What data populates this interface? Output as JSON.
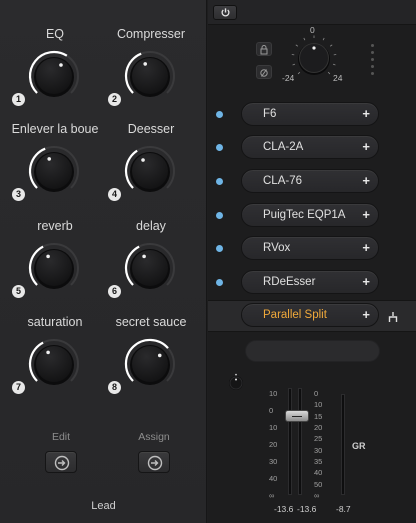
{
  "macros": {
    "knobs": [
      {
        "label": "EQ",
        "number": "1",
        "value": 0.62
      },
      {
        "label": "Compresser",
        "number": "2",
        "value": 0.42
      },
      {
        "label": "Enlever la boue",
        "number": "3",
        "value": 0.42
      },
      {
        "label": "Deesser",
        "number": "4",
        "value": 0.38
      },
      {
        "label": "reverb",
        "number": "5",
        "value": 0.4
      },
      {
        "label": "delay",
        "number": "6",
        "value": 0.4
      },
      {
        "label": "saturation",
        "number": "7",
        "value": 0.4
      },
      {
        "label": "secret sauce",
        "number": "8",
        "value": 0.68
      }
    ],
    "edit_label": "Edit",
    "assign_label": "Assign",
    "preset_name": "Lead",
    "accent_color": "#ffffff"
  },
  "chain": {
    "power_icon": "power-icon",
    "gain_scale": {
      "top": "0",
      "left": "-24",
      "right": "24"
    },
    "gain_value": 0.5,
    "plugins": [
      {
        "name": "F6",
        "plus": "+"
      },
      {
        "name": "CLA-2A",
        "plus": "+"
      },
      {
        "name": "CLA-76",
        "plus": "+"
      },
      {
        "name": "PuigTec EQP1A",
        "plus": "+"
      },
      {
        "name": "RVox",
        "plus": "+"
      },
      {
        "name": "RDeEsser",
        "plus": "+"
      },
      {
        "name": "Parallel Split",
        "plus": "+",
        "highlight_color": "#f0a93b"
      }
    ],
    "slot_dot_color": "#6fb5e6"
  },
  "meters": {
    "left_scale": [
      "10",
      "0",
      "10",
      "20",
      "30",
      "40",
      "∞"
    ],
    "right_scale": [
      "0",
      "10",
      "15",
      "20",
      "25",
      "30",
      "35",
      "40",
      "50",
      "∞"
    ],
    "readout_left": "-13.6",
    "readout_right": "-13.6",
    "gr_label": "GR",
    "gr_readout": "-8.7"
  }
}
